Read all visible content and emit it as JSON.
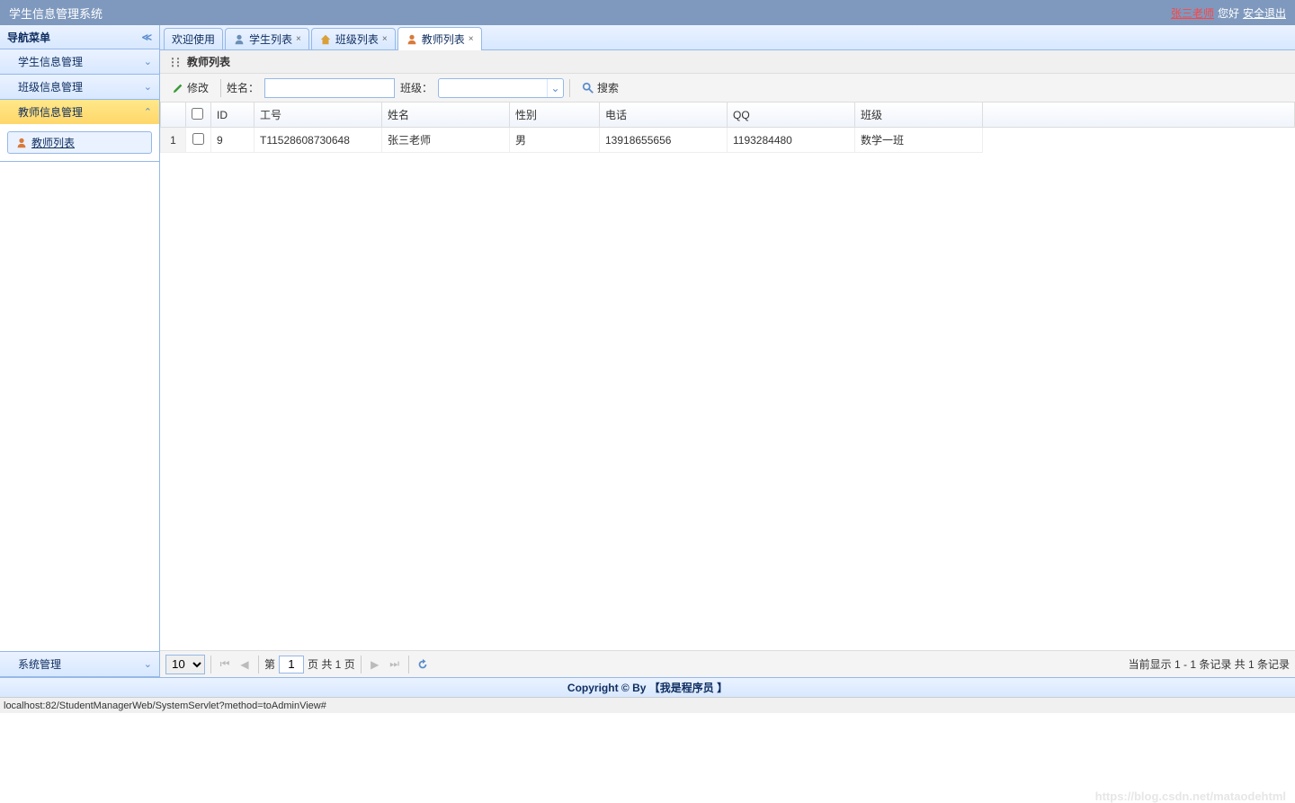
{
  "header": {
    "title": "学生信息管理系统",
    "user": "张三老师",
    "greeting": "您好",
    "logout": "安全退出"
  },
  "sidebar": {
    "title": "导航菜单",
    "groups": [
      {
        "label": "学生信息管理",
        "expanded": false
      },
      {
        "label": "班级信息管理",
        "expanded": false
      },
      {
        "label": "教师信息管理",
        "expanded": true
      }
    ],
    "teacher_link": "教师列表",
    "sys_label": "系统管理"
  },
  "tabs": [
    {
      "label": "欢迎使用",
      "closable": false,
      "icon": null
    },
    {
      "label": "学生列表",
      "closable": true,
      "icon": "user"
    },
    {
      "label": "班级列表",
      "closable": true,
      "icon": "home"
    },
    {
      "label": "教师列表",
      "closable": true,
      "icon": "user",
      "active": true
    }
  ],
  "panel": {
    "title": "教师列表"
  },
  "toolbar": {
    "edit_label": "修改",
    "name_label": "姓名：",
    "class_label": "班级：",
    "search_label": "搜索"
  },
  "table": {
    "columns": [
      "ID",
      "工号",
      "姓名",
      "性别",
      "电话",
      "QQ",
      "班级"
    ],
    "rows": [
      {
        "num": "1",
        "id": "9",
        "sno": "T11528608730648",
        "name": "张三老师",
        "sex": "男",
        "tel": "13918655656",
        "qq": "1193284480",
        "clazz": "数学一班"
      }
    ]
  },
  "pagination": {
    "page_size": "10",
    "prefix": "第",
    "page": "1",
    "suffix": "页 共 1 页",
    "info": "当前显示 1 - 1 条记录 共 1 条记录"
  },
  "footer": {
    "copyright": "Copyright © By 【我是程序员 】"
  },
  "status": {
    "url": "localhost:82/StudentManagerWeb/SystemServlet?method=toAdminView#"
  },
  "watermark": "https://blog.csdn.net/mataodehtml"
}
